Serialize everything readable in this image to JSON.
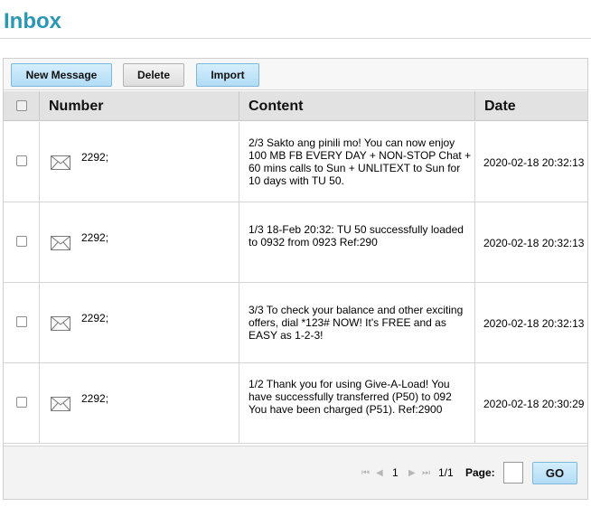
{
  "page": {
    "title": "Inbox"
  },
  "toolbar": {
    "new_message_label": "New Message",
    "delete_label": "Delete",
    "import_label": "Import"
  },
  "table": {
    "headers": {
      "number": "Number",
      "content": "Content",
      "date": "Date"
    },
    "rows": [
      {
        "number": "2292;",
        "content": "2/3 Sakto ang pinili mo! You can now enjoy 100 MB FB EVERY DAY + NON-STOP Chat + 60 mins calls to Sun + UNLITEXT to Sun for 10 days with TU 50.",
        "date": "2020-02-18 20:32:13"
      },
      {
        "number": "2292;",
        "content": "1/3 18-Feb 20:32: TU 50 successfully loaded to 0932 from 0923 Ref:290",
        "date": "2020-02-18 20:32:13"
      },
      {
        "number": "2292;",
        "content": "3/3 To check your balance and other exciting offers, dial *123# NOW! It's FREE and as EASY as 1-2-3!",
        "date": "2020-02-18 20:32:13"
      },
      {
        "number": "2292;",
        "content": "1/2 Thank you for using Give-A-Load! You have successfully transferred (P50) to 092 You have been charged (P51). Ref:2900",
        "date": "2020-02-18 20:30:29"
      }
    ]
  },
  "pagination": {
    "current_page": "1",
    "page_count": "1/1",
    "page_label": "Page:",
    "page_input_value": "",
    "go_label": "GO"
  },
  "icons": {
    "row_icon": "envelope-icon",
    "first": "first-page-icon",
    "prev": "prev-page-icon",
    "next": "next-page-icon",
    "last": "last-page-icon"
  },
  "colors": {
    "title": "#2a98b4",
    "blue_button": "#b2dcf6",
    "header_bg": "#e2e2e2"
  }
}
